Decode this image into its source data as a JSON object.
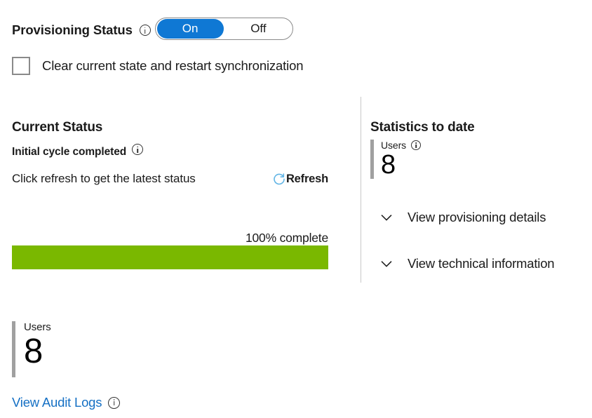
{
  "provisioning": {
    "label": "Provisioning Status",
    "info_icon": "info-icon",
    "toggle": {
      "on_label": "On",
      "off_label": "Off",
      "selected": "On",
      "on_color": "#0f78d4"
    }
  },
  "clear_state": {
    "label": "Clear current state and restart synchronization",
    "checked": false
  },
  "current_status": {
    "title": "Current Status",
    "cycle_status": "Initial cycle completed",
    "cycle_info_icon": "info-icon",
    "refresh_hint": "Click refresh to get the latest status",
    "refresh_label": "Refresh",
    "refresh_icon": "refresh-icon",
    "refresh_icon_color": "#62B5E5",
    "progress": {
      "percent_label": "100% complete",
      "percent": 100,
      "fill_color": "#7ab800"
    }
  },
  "statistics": {
    "title": "Statistics to date",
    "stat": {
      "name": "Users",
      "value": "8",
      "info_icon": "info-icon",
      "accent_color": "#a0a0a0"
    },
    "expanders": [
      {
        "label": "View provisioning details",
        "icon": "chevron-down-icon",
        "expanded": false
      },
      {
        "label": "View technical information",
        "icon": "chevron-down-icon",
        "expanded": false
      }
    ]
  },
  "summary_stat": {
    "name": "Users",
    "value": "8",
    "accent_color": "#a0a0a0"
  },
  "audit": {
    "link_label": "View Audit Logs",
    "info_icon": "info-icon",
    "link_color": "#1570c4"
  }
}
